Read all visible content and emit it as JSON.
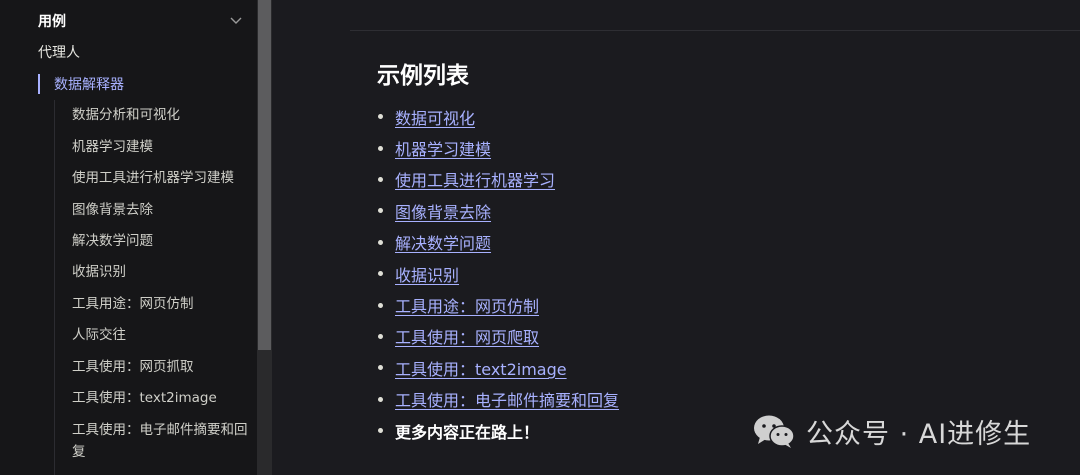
{
  "sidebar": {
    "group_title": "用例",
    "top_item": "代理人",
    "active_item": "数据解释器",
    "sub_items": [
      "数据分析和可视化",
      "机器学习建模",
      "使用工具进行机器学习建模",
      "图像背景去除",
      "解决数学问题",
      "收据识别",
      "工具用途：网页仿制",
      "人际交往",
      "工具使用：网页抓取",
      "工具使用：text2image",
      "工具使用：电子邮件摘要和回复"
    ]
  },
  "main": {
    "heading": "示例列表",
    "links": [
      "数据可视化",
      "机器学习建模",
      "使用工具进行机器学习",
      "图像背景去除",
      "解决数学问题",
      "收据识别",
      "工具用途：网页仿制",
      "工具使用：网页爬取",
      "工具使用：text2image",
      "工具使用：电子邮件摘要和回复"
    ],
    "more_text": "更多内容正在路上！"
  },
  "watermark": {
    "text": "公众号 · AI进修生",
    "icon": "wechat-icon"
  },
  "colors": {
    "accent": "#a8b1ff",
    "sidebar_bg": "#161618",
    "main_bg": "#1b1b1f"
  }
}
